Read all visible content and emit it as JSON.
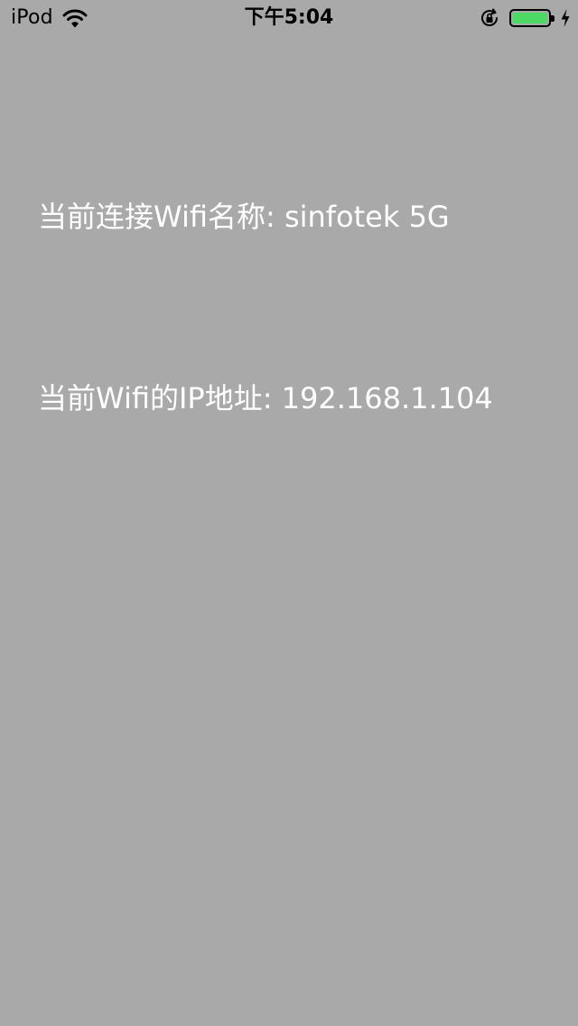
{
  "status_bar": {
    "carrier": "iPod",
    "time": "下午5:04",
    "battery_level": 1.0,
    "battery_color": "#4cd964",
    "icons": [
      "wifi-icon",
      "rotation-lock-icon",
      "charging-bolt-icon"
    ]
  },
  "content": {
    "wifi_name_label": "当前连接Wifi名称: sinfotek 5G",
    "ip_label": "当前Wifi的IP地址: 192.168.1.104"
  },
  "colors": {
    "background": "#a9a9a9",
    "text": "#ffffff"
  }
}
